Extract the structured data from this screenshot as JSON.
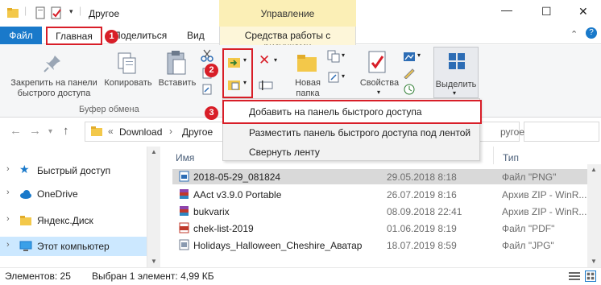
{
  "window": {
    "title": "Другое",
    "contextual_tab_group": "Управление",
    "minimize_icon": "minimize-icon",
    "maximize_icon": "maximize-icon",
    "close_icon": "close-icon"
  },
  "tabs": {
    "file": "Файл",
    "home": "Главная",
    "share": "Поделиться",
    "view": "Вид",
    "picture_tools": "Средства работы с рисунками"
  },
  "badges": {
    "one": "1",
    "two": "2",
    "three": "3"
  },
  "ribbon": {
    "pin_label_line1": "Закрепить на панели",
    "pin_label_line2": "быстрого доступа",
    "copy_label": "Копировать",
    "paste_label": "Вставить",
    "clipboard_group": "Буфер обмена",
    "new_folder_line1": "Новая",
    "new_folder_line2": "папка",
    "properties_label": "Свойства",
    "select_label": "Выделить"
  },
  "dropdown": {
    "item1": "Добавить на панель быстрого доступа",
    "item2": "Разместить панель быстрого доступа под лентой",
    "item3": "Свернуть ленту"
  },
  "address": {
    "prefix": "«",
    "crumb1": "Download",
    "sep": "›",
    "crumb2": "Другое",
    "search_suffix": "ругое"
  },
  "nav": {
    "items": [
      {
        "label": "Быстрый доступ"
      },
      {
        "label": "OneDrive"
      },
      {
        "label": "Яндекс.Диск"
      },
      {
        "label": "Этот компьютер"
      }
    ]
  },
  "columns": {
    "name": "Имя",
    "type": "Тип"
  },
  "files": [
    {
      "name": "2018-05-29_081824",
      "date": "29.05.2018 8:18",
      "type": "Файл \"PNG\""
    },
    {
      "name": "AAct v3.9.0 Portable",
      "date": "26.07.2019 8:16",
      "type": "Архив ZIP - WinR..."
    },
    {
      "name": "bukvarix",
      "date": "08.09.2018 22:41",
      "type": "Архив ZIP - WinR..."
    },
    {
      "name": "chek-list-2019",
      "date": "01.06.2019 8:19",
      "type": "Файл \"PDF\""
    },
    {
      "name": "Holidays_Halloween_Cheshire_Аватар",
      "date": "18.07.2019 8:59",
      "type": "Файл \"JPG\""
    }
  ],
  "status": {
    "count": "Элементов: 25",
    "selected": "Выбран 1 элемент: 4,99 КБ"
  },
  "colors": {
    "accent": "#1979ca",
    "highlight": "#d81e28",
    "manage_bg": "#fbefb6",
    "selected_nav": "#cce8ff"
  }
}
